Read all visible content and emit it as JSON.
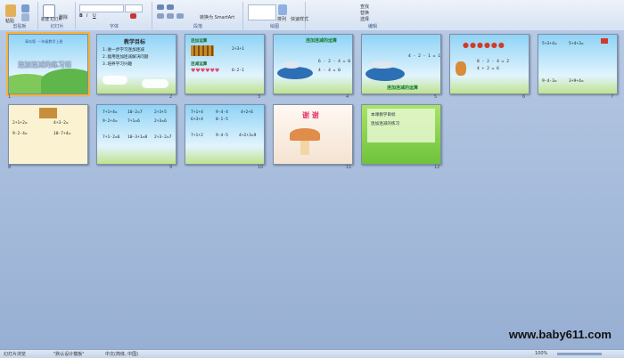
{
  "ribbon": {
    "groups": [
      {
        "label": "剪贴板"
      },
      {
        "label": "幻灯片"
      },
      {
        "label": "字体"
      },
      {
        "label": "段落"
      },
      {
        "label": "绘图"
      },
      {
        "label": "编辑"
      }
    ],
    "paste_label": "粘贴",
    "new_slide_label": "新建\n幻灯片",
    "delete_label": "删除",
    "convert_smartart_label": "转换为 SmartArt",
    "arrange_label": "排列",
    "quick_styles_label": "快速样式",
    "find_label": "查找",
    "replace_label": "替换",
    "select_label": "选择"
  },
  "slides": [
    {
      "num": "1",
      "title": "连加连减的练习课",
      "subtitle": "青岛版 一年级数学上册"
    },
    {
      "num": "2",
      "title": "教学目标",
      "lines": [
        "1.进一步学习连加连减",
        "2.能用连加连减解决问题",
        "3.培养学习兴趣"
      ]
    },
    {
      "num": "3",
      "labels": [
        "连加运算",
        "连减运算"
      ]
    },
    {
      "num": "4",
      "title": "连加连减的运算",
      "eqs": [
        "6 - 2 - 4 = 0",
        "4 - 4 = 0"
      ]
    },
    {
      "num": "5",
      "title": "连加连减的运算",
      "eqs": [
        "4 - 2 - 1 = 1"
      ]
    },
    {
      "num": "6",
      "eqs": [
        "8 - 2 - 4 = 2",
        "4 + 2 = 6"
      ]
    },
    {
      "num": "7",
      "eqs": [
        "5+3+4=",
        "5+4+3=",
        "9-4-3=",
        "3+9+4="
      ]
    },
    {
      "num": "8",
      "eqs": [
        "2+1+2=",
        "4+3-2=",
        "9-2-4=",
        "10-7+4="
      ]
    },
    {
      "num": "9",
      "eqs": [
        "7+1+4=",
        "10-2=7",
        "2+3+5",
        "9-2+4=",
        "7+1=6",
        "2+3=6",
        "7+1-2=6",
        "10-3+1=8",
        "2+3-2=7"
      ]
    },
    {
      "num": "10",
      "eqs": [
        "7+1+4",
        "9-4-4",
        "4+2+6",
        "6+3+4",
        "8-1-5",
        "7+1+2",
        "9-4-5",
        "4+2+3=9"
      ]
    },
    {
      "num": "11",
      "title": "谢 谢"
    },
    {
      "num": "12",
      "lines": [
        "本课教学目标",
        "连加连减的练习"
      ]
    }
  ],
  "watermark": "www.baby611.com",
  "statusbar": {
    "slide_info": "幻灯片浏览",
    "theme": "\"默认设计模板\"",
    "language": "中文(简体, 中国)",
    "zoom": "100%"
  },
  "colors": {
    "accent": "#f3b33d",
    "ribbon": "#d5e1f2",
    "workspace": "#a7bde0"
  }
}
